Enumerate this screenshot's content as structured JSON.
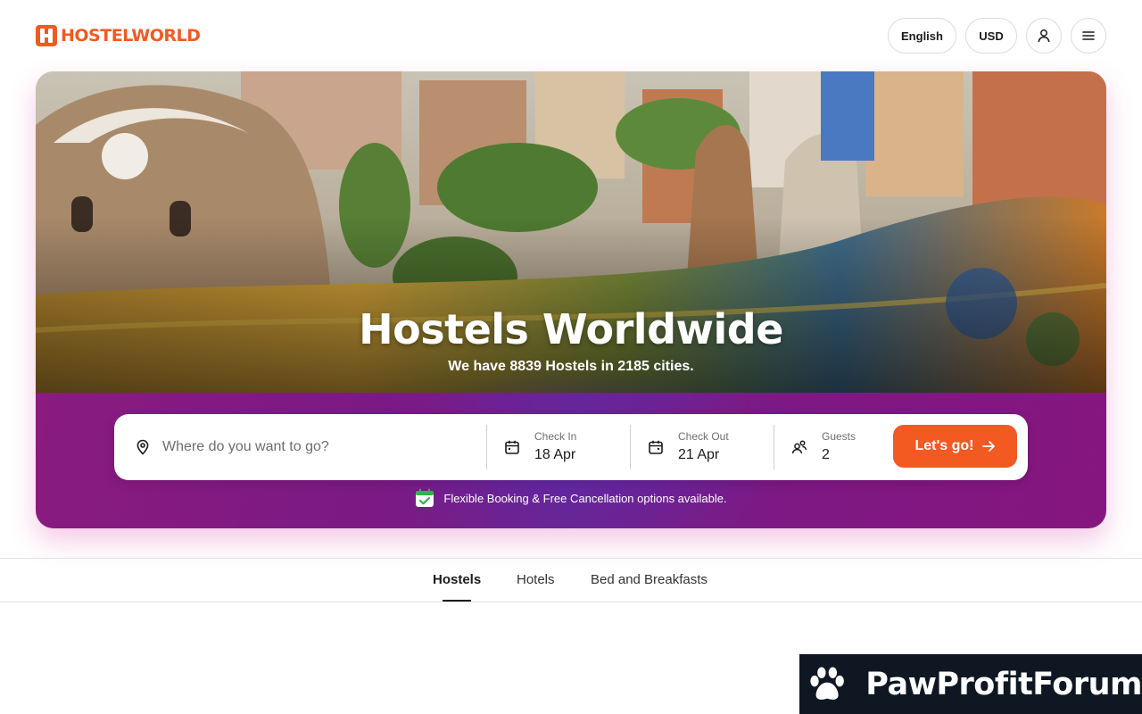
{
  "brand": {
    "logo_text": "HOSTELWORLD",
    "accent": "#f25a22"
  },
  "header": {
    "language": "English",
    "currency": "USD",
    "account_icon": "user-icon",
    "menu_icon": "hamburger-menu-icon"
  },
  "hero": {
    "title": "Hostels Worldwide",
    "subtitle": "We have 8839 Hostels in 2185 cities.",
    "band_color": "#7e1883"
  },
  "search": {
    "destination_placeholder": "Where do you want to go?",
    "destination_value": "",
    "check_in": {
      "label": "Check In",
      "value": "18 Apr"
    },
    "check_out": {
      "label": "Check Out",
      "value": "21 Apr"
    },
    "guests": {
      "label": "Guests",
      "value": "2"
    },
    "submit_label": "Let's go!"
  },
  "note": {
    "text": "Flexible Booking & Free Cancellation options available."
  },
  "tabs": [
    {
      "label": "Hostels",
      "active": true
    },
    {
      "label": "Hotels",
      "active": false
    },
    {
      "label": "Bed and Breakfasts",
      "active": false
    }
  ],
  "watermark": {
    "text": "PawProfitForum",
    "icon": "paw-icon"
  }
}
